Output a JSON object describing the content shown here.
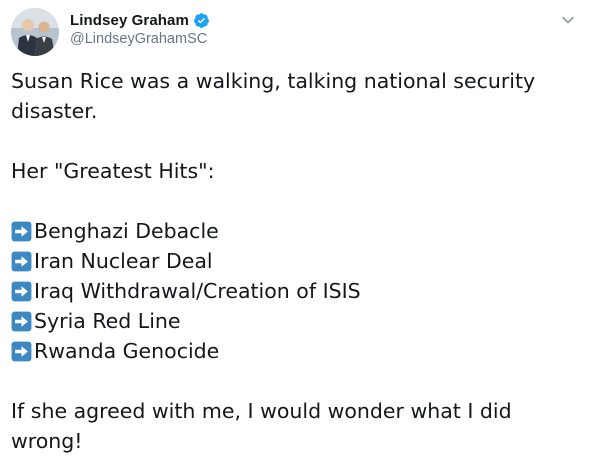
{
  "tweet": {
    "author": {
      "display_name": "Lindsey Graham",
      "handle": "@LindseyGrahamSC",
      "avatar_icon": "profile-photo",
      "verified_icon": "verified-badge-icon"
    },
    "menu_icon": "chevron-down-icon",
    "paragraphs": [
      "Susan Rice was a walking, talking national security disaster.",
      "Her \"Greatest Hits\":"
    ],
    "list_icon": "right-arrow-emoji-icon",
    "list_items": [
      "Benghazi Debacle",
      "Iran Nuclear Deal",
      "Iraq Withdrawal/Creation of ISIS",
      "Syria Red Line",
      "Rwanda Genocide"
    ],
    "closing": "If she agreed with me, I would wonder what I did wrong!"
  },
  "colors": {
    "text": "#14171a",
    "secondary": "#657786",
    "verified": "#1da1f2",
    "arrow_box": "#3b88c3"
  }
}
